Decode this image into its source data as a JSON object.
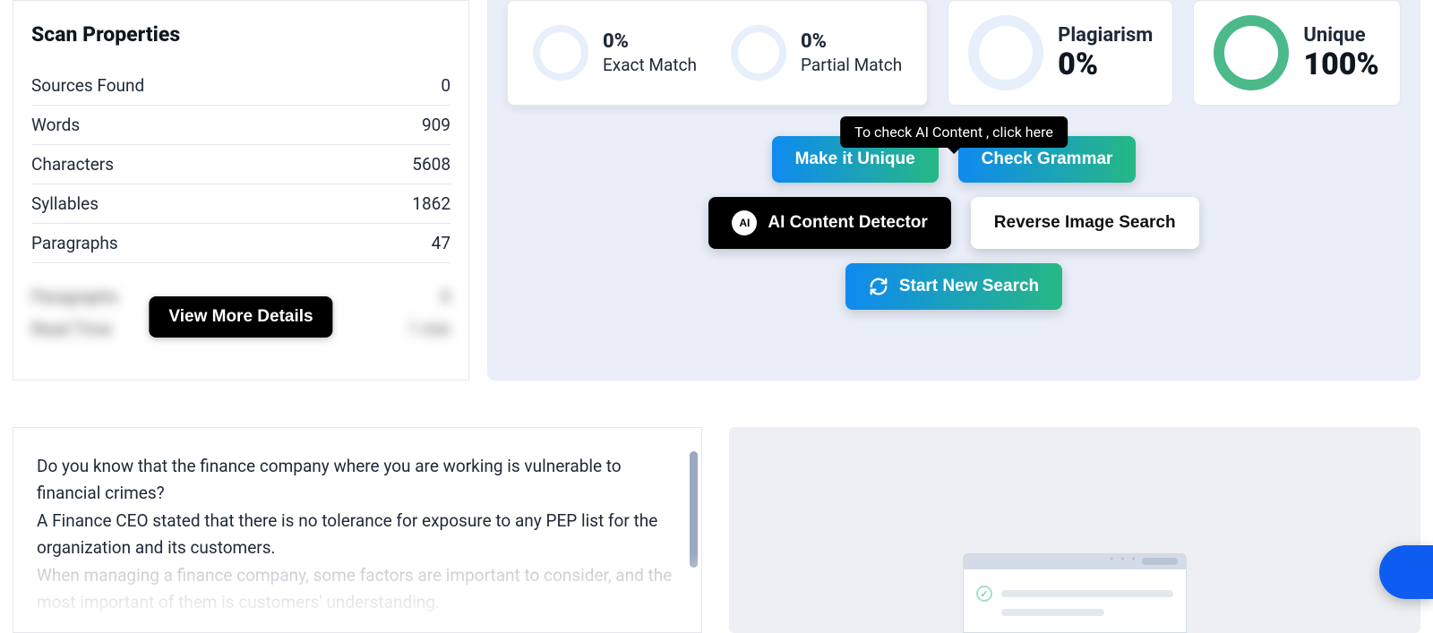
{
  "scan": {
    "title": "Scan Properties",
    "rows": [
      {
        "label": "Sources Found",
        "value": "0"
      },
      {
        "label": "Words",
        "value": "909"
      },
      {
        "label": "Characters",
        "value": "5608"
      },
      {
        "label": "Syllables",
        "value": "1862"
      },
      {
        "label": "Paragraphs",
        "value": "47"
      }
    ],
    "blurred": [
      {
        "label": "Paragraphs",
        "value": "0"
      },
      {
        "label": "Read Time",
        "value": "1 min"
      }
    ],
    "view_more": "View More Details"
  },
  "results": {
    "exact": {
      "pct": "0%",
      "label": "Exact Match"
    },
    "partial": {
      "pct": "0%",
      "label": "Partial Match"
    },
    "plagiarism": {
      "label": "Plagiarism",
      "pct": "0%"
    },
    "unique": {
      "label": "Unique",
      "pct": "100%"
    }
  },
  "buttons": {
    "make_unique": "Make it Unique",
    "check_grammar": "Check Grammar",
    "ai_detector": "AI Content Detector",
    "reverse_image": "Reverse Image Search",
    "start_new": "Start New Search"
  },
  "tooltip": "To check AI Content , click here",
  "content": {
    "p1": "Do you know that the finance company where you are working is vulnerable to financial crimes?",
    "p2": "A Finance CEO stated that there is no tolerance for exposure to any PEP list for the organization and its customers.",
    "p3": "When managing a finance company, some factors are important to consider, and the most important of them is customers' understanding."
  }
}
